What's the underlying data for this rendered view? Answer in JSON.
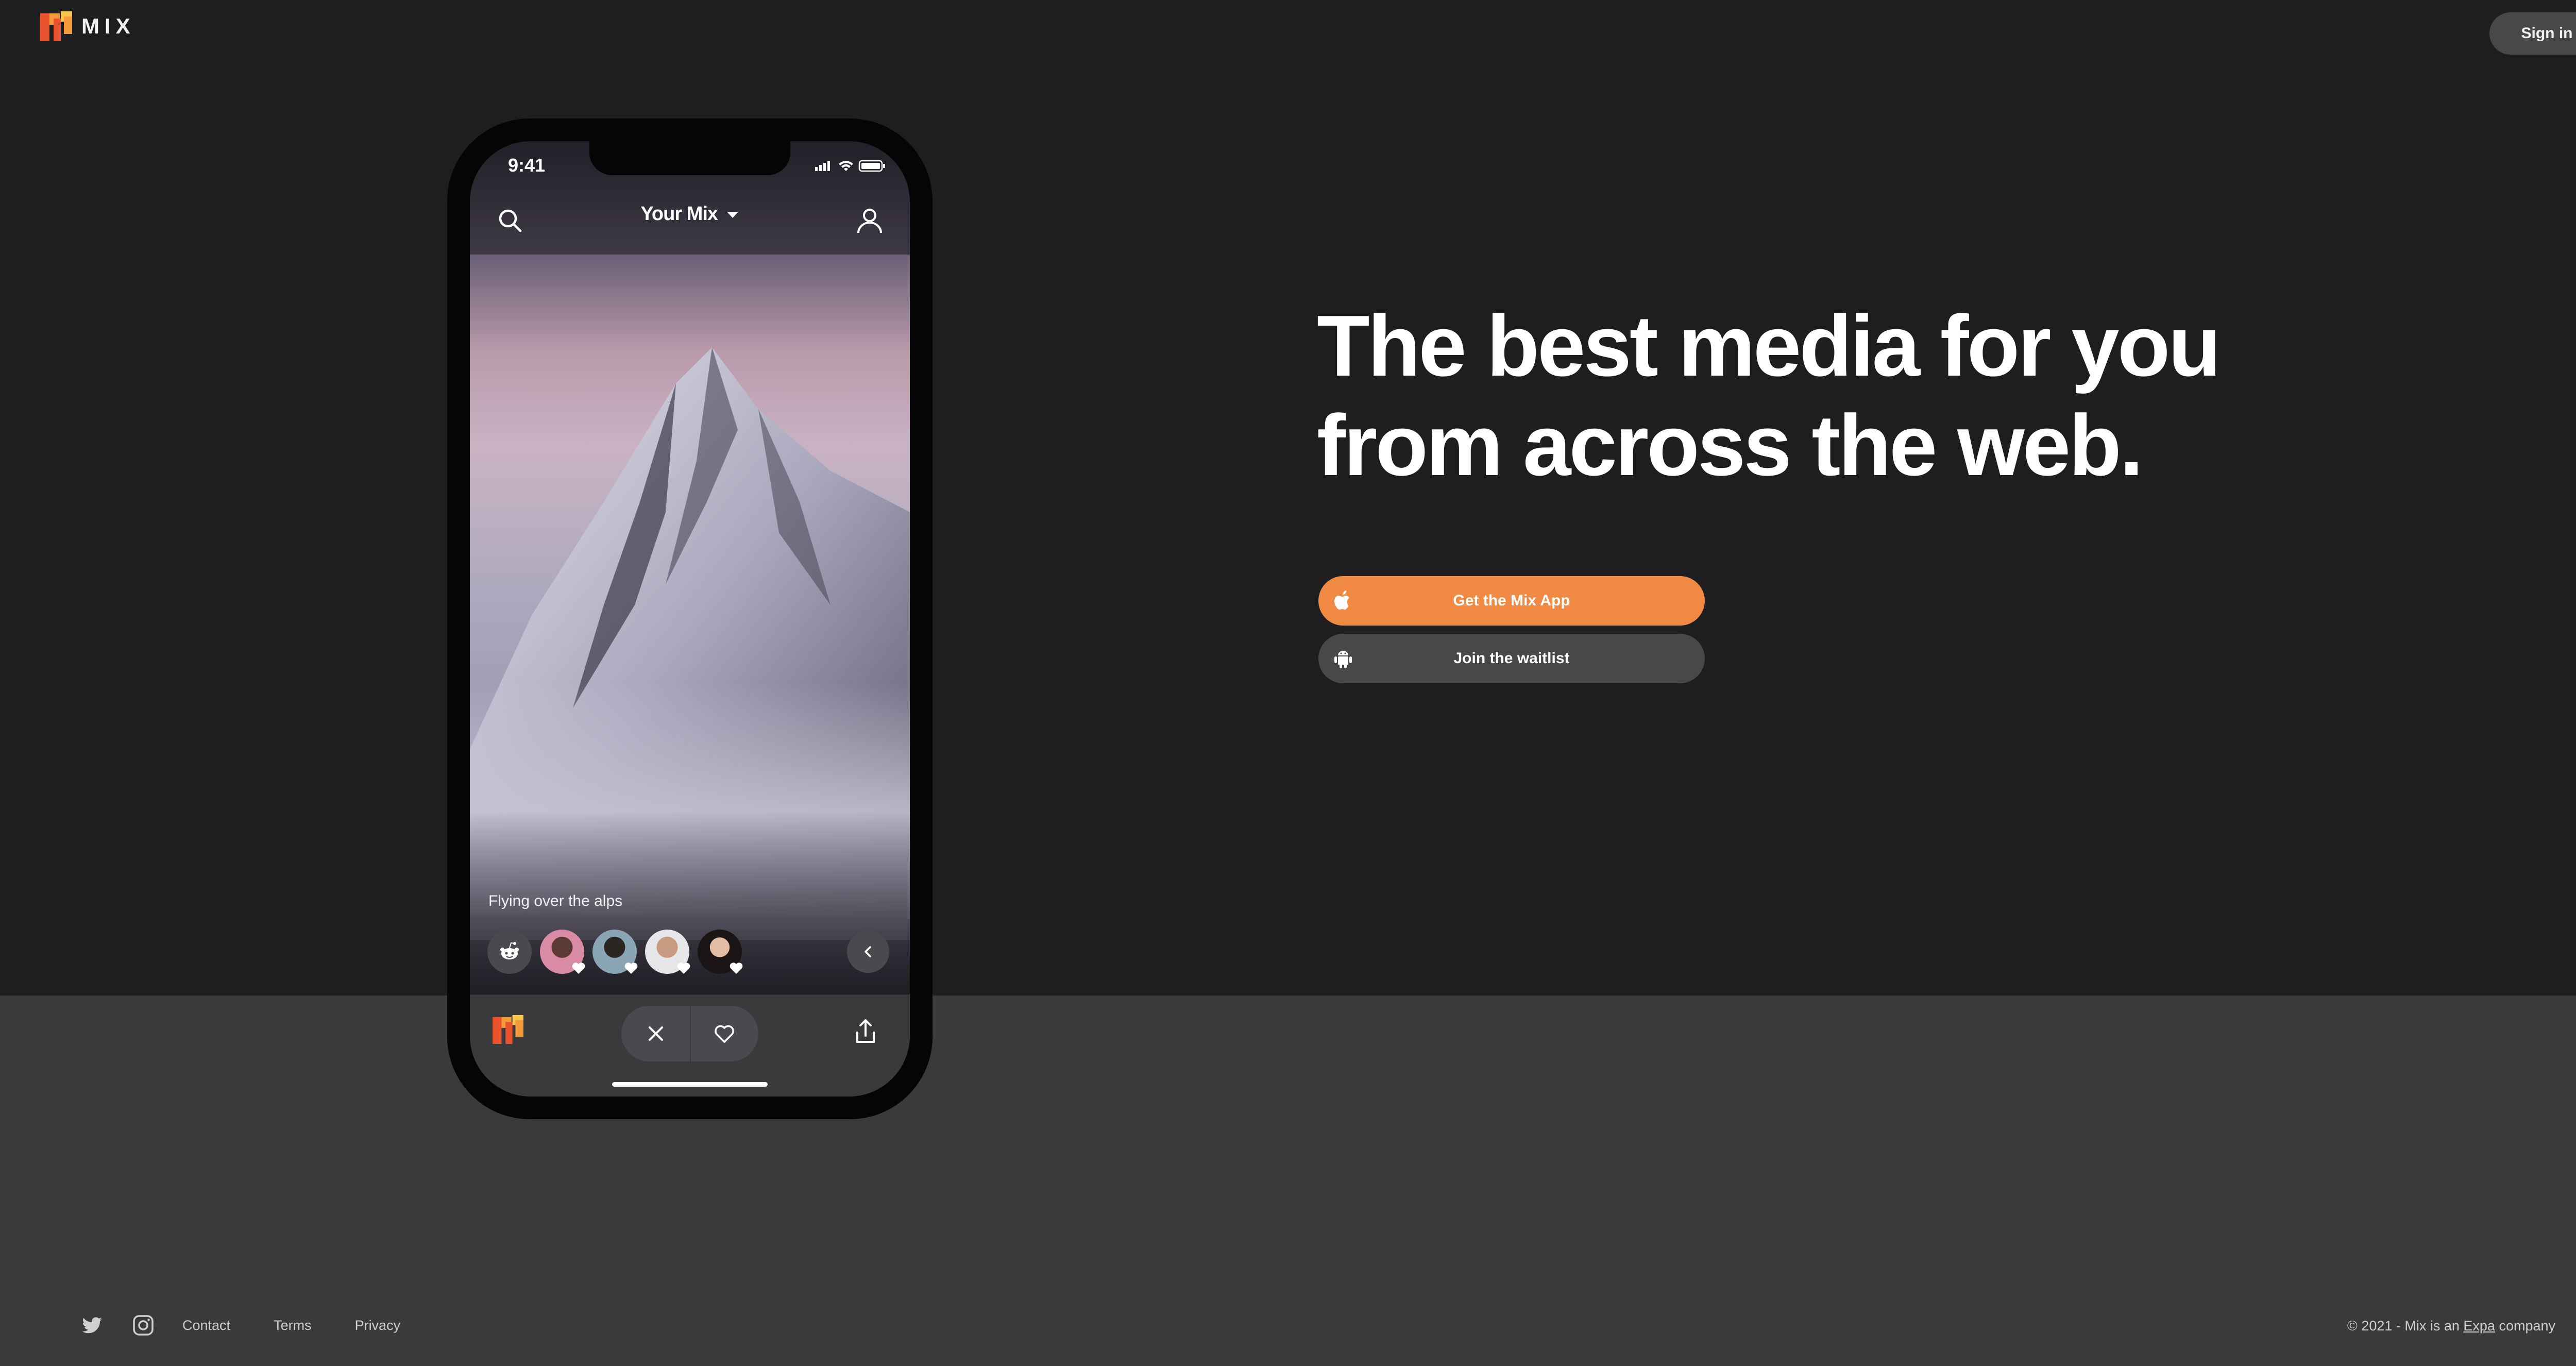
{
  "header": {
    "brand": "MIX",
    "signin_label": "Sign in"
  },
  "hero": {
    "line1": "The best media for you",
    "line2": "from across the web."
  },
  "cta": {
    "primary_label": "Get the Mix App",
    "primary_icon": "apple-icon",
    "secondary_label": "Join the waitlist",
    "secondary_icon": "android-icon"
  },
  "phone": {
    "time": "9:41",
    "feed_title": "Your Mix",
    "caption": "Flying over the alps",
    "top_icons": [
      "search-icon",
      "profile-icon"
    ],
    "tab_icons": [
      "mix-logo-icon",
      "close-icon",
      "heart-icon",
      "share-icon"
    ]
  },
  "footer": {
    "links": [
      "Contact",
      "Terms",
      "Privacy"
    ],
    "copyright_prefix": "© 2021 - Mix is an ",
    "copyright_link": "Expa",
    "copyright_suffix": " company",
    "social_icons": [
      "twitter-icon",
      "instagram-icon"
    ]
  },
  "colors": {
    "background": "#1e1e20",
    "lower_band": "#3a3a3c",
    "accent": "#f08a42",
    "secondary_button": "#48484a"
  }
}
